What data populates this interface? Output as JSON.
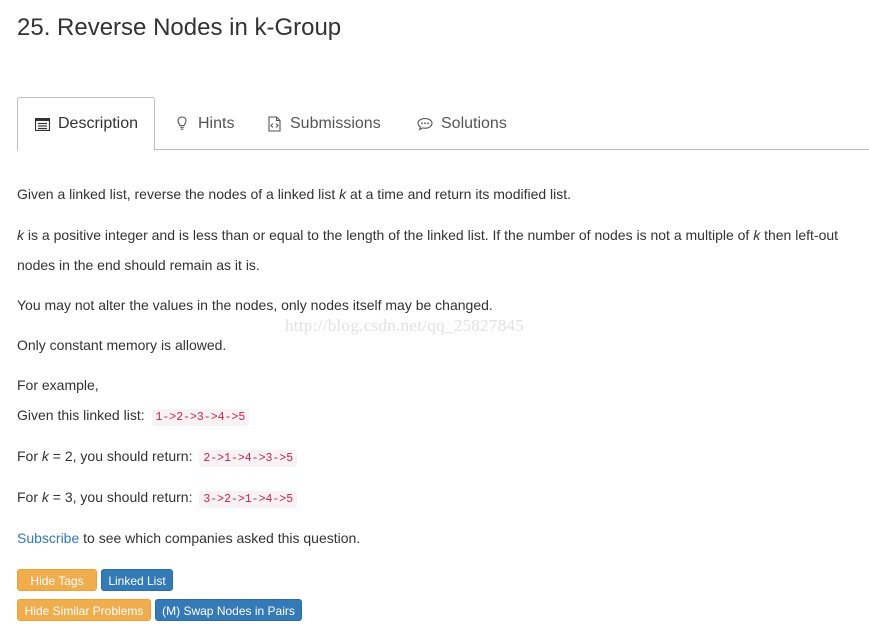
{
  "problem": {
    "title": "25. Reverse Nodes in k-Group"
  },
  "tabs": [
    {
      "label": "Description",
      "icon": "list-alt-icon",
      "active": true
    },
    {
      "label": "Hints",
      "icon": "lightbulb-icon",
      "active": false
    },
    {
      "label": "Submissions",
      "icon": "code-file-icon",
      "active": false
    },
    {
      "label": "Solutions",
      "icon": "comment-icon",
      "active": false
    }
  ],
  "description": {
    "p1_before": "Given a linked list, reverse the nodes of a linked list ",
    "k": "k",
    "p1_after": " at a time and return its modified list.",
    "p2_after_k": " is a positive integer and is less than or equal to the length of the linked list. If the number of nodes is not a multiple of ",
    "p2_end": " then left-out",
    "p2_line2": "nodes in the end should remain as it is.",
    "p3": "You may not alter the values in the nodes, only nodes itself may be changed.",
    "p4": "Only constant memory is allowed.",
    "p5": "For example,",
    "p6_text": "Given this linked list: ",
    "p6_code": "1->2->3->4->5",
    "p7_before": "For ",
    "p7_eq": " = 2, you should return: ",
    "p7_code": "2->1->4->3->5",
    "p8_before": "For ",
    "p8_eq": " = 3, you should return: ",
    "p8_code": "3->2->1->4->5",
    "subscribe_link": "Subscribe",
    "subscribe_rest": " to see which companies asked this question."
  },
  "watermark": "http://blog.csdn.net/qq_25827845",
  "buttons": {
    "hide_tags": "Hide Tags",
    "tag_linked_list": "Linked List",
    "hide_similar": "Hide Similar Problems",
    "similar_swap": "(M) Swap Nodes in Pairs"
  },
  "colors": {
    "warning": "#f0ad4e",
    "primary": "#337ab7",
    "code_text": "#c7254e",
    "code_bg": "#f9f2f4",
    "link": "#337ab7"
  }
}
